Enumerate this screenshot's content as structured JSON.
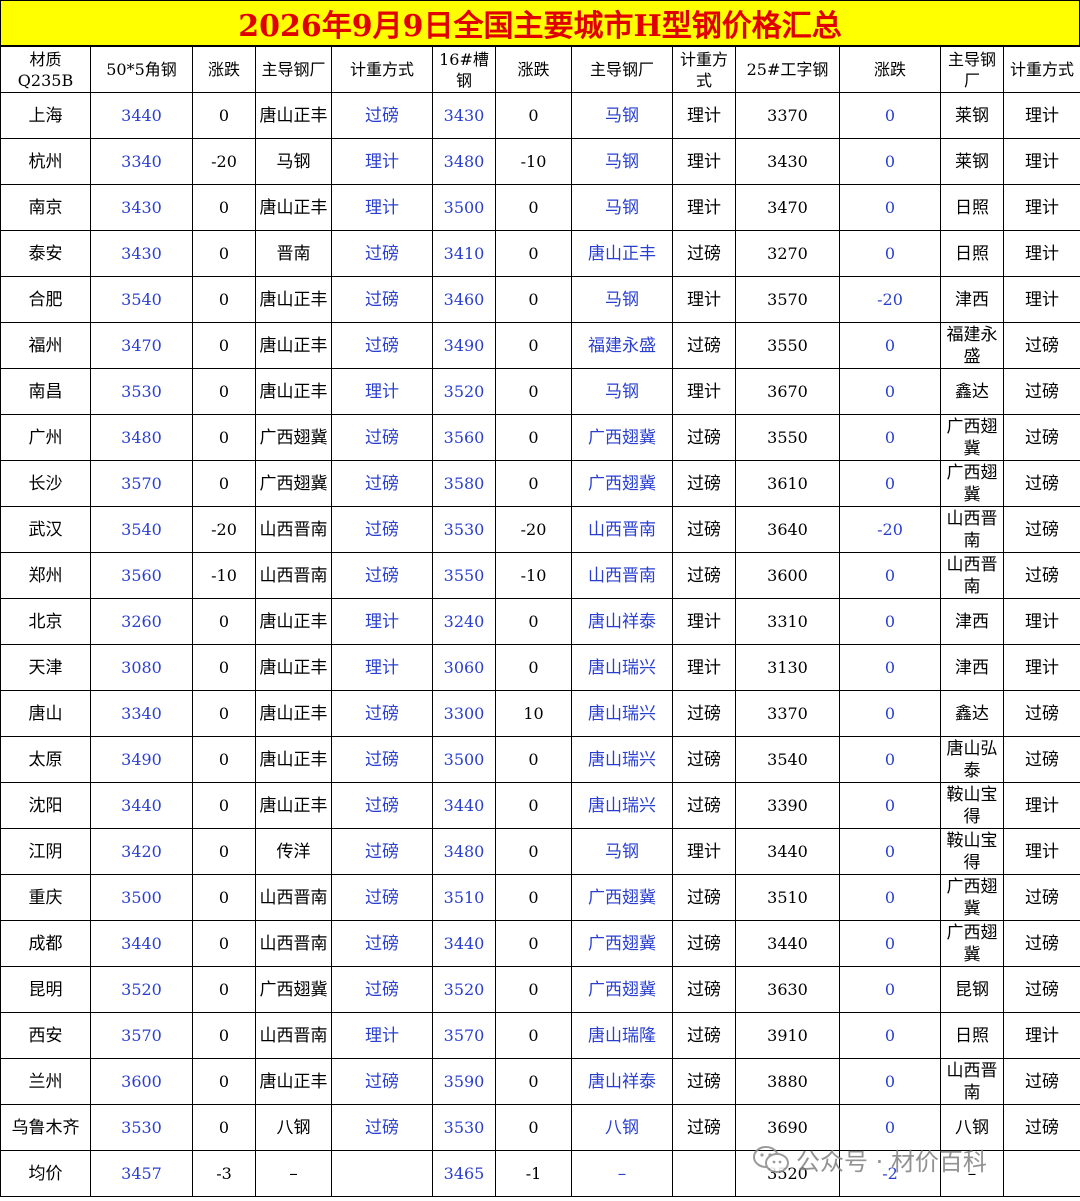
{
  "title": "2026年9月9日全国主要城市H型钢价格汇总",
  "headers": [
    "材质Q235B",
    "50*5角钢",
    "涨跌",
    "主导钢厂",
    "计重方式",
    "16#槽钢",
    "涨跌",
    "主导钢厂",
    "计重方式",
    "25#工字钢",
    "涨跌",
    "主导钢厂",
    "计重方式"
  ],
  "rows": [
    [
      "上海",
      "3440",
      "0",
      "唐山正丰",
      "过磅",
      "3430",
      "0",
      "马钢",
      "理计",
      "3370",
      "0",
      "莱钢",
      "理计"
    ],
    [
      "杭州",
      "3340",
      "-20",
      "马钢",
      "理计",
      "3480",
      "-10",
      "马钢",
      "理计",
      "3430",
      "0",
      "莱钢",
      "理计"
    ],
    [
      "南京",
      "3430",
      "0",
      "唐山正丰",
      "理计",
      "3500",
      "0",
      "马钢",
      "理计",
      "3470",
      "0",
      "日照",
      "理计"
    ],
    [
      "泰安",
      "3430",
      "0",
      "晋南",
      "过磅",
      "3410",
      "0",
      "唐山正丰",
      "过磅",
      "3270",
      "0",
      "日照",
      "理计"
    ],
    [
      "合肥",
      "3540",
      "0",
      "唐山正丰",
      "过磅",
      "3460",
      "0",
      "马钢",
      "理计",
      "3570",
      "-20",
      "津西",
      "理计"
    ],
    [
      "福州",
      "3470",
      "0",
      "唐山正丰",
      "过磅",
      "3490",
      "0",
      "福建永盛",
      "过磅",
      "3550",
      "0",
      "福建永盛",
      "过磅"
    ],
    [
      "南昌",
      "3530",
      "0",
      "唐山正丰",
      "理计",
      "3520",
      "0",
      "马钢",
      "理计",
      "3670",
      "0",
      "鑫达",
      "过磅"
    ],
    [
      "广州",
      "3480",
      "0",
      "广西翅冀",
      "过磅",
      "3560",
      "0",
      "广西翅冀",
      "过磅",
      "3550",
      "0",
      "广西翅冀",
      "过磅"
    ],
    [
      "长沙",
      "3570",
      "0",
      "广西翅冀",
      "过磅",
      "3580",
      "0",
      "广西翅冀",
      "过磅",
      "3610",
      "0",
      "广西翅冀",
      "过磅"
    ],
    [
      "武汉",
      "3540",
      "-20",
      "山西晋南",
      "过磅",
      "3530",
      "-20",
      "山西晋南",
      "过磅",
      "3640",
      "-20",
      "山西晋南",
      "过磅"
    ],
    [
      "郑州",
      "3560",
      "-10",
      "山西晋南",
      "过磅",
      "3550",
      "-10",
      "山西晋南",
      "过磅",
      "3600",
      "0",
      "山西晋南",
      "过磅"
    ],
    [
      "北京",
      "3260",
      "0",
      "唐山正丰",
      "理计",
      "3240",
      "0",
      "唐山祥泰",
      "理计",
      "3310",
      "0",
      "津西",
      "理计"
    ],
    [
      "天津",
      "3080",
      "0",
      "唐山正丰",
      "理计",
      "3060",
      "0",
      "唐山瑞兴",
      "理计",
      "3130",
      "0",
      "津西",
      "理计"
    ],
    [
      "唐山",
      "3340",
      "0",
      "唐山正丰",
      "过磅",
      "3300",
      "10",
      "唐山瑞兴",
      "过磅",
      "3370",
      "0",
      "鑫达",
      "过磅"
    ],
    [
      "太原",
      "3490",
      "0",
      "唐山正丰",
      "过磅",
      "3500",
      "0",
      "唐山瑞兴",
      "过磅",
      "3540",
      "0",
      "唐山弘泰",
      "过磅"
    ],
    [
      "沈阳",
      "3440",
      "0",
      "唐山正丰",
      "过磅",
      "3440",
      "0",
      "唐山瑞兴",
      "过磅",
      "3390",
      "0",
      "鞍山宝得",
      "理计"
    ],
    [
      "江阴",
      "3420",
      "0",
      "传洋",
      "过磅",
      "3480",
      "0",
      "马钢",
      "理计",
      "3440",
      "0",
      "鞍山宝得",
      "理计"
    ],
    [
      "重庆",
      "3500",
      "0",
      "山西晋南",
      "过磅",
      "3510",
      "0",
      "广西翅冀",
      "过磅",
      "3510",
      "0",
      "广西翅冀",
      "过磅"
    ],
    [
      "成都",
      "3440",
      "0",
      "山西晋南",
      "过磅",
      "3440",
      "0",
      "广西翅冀",
      "过磅",
      "3440",
      "0",
      "广西翅冀",
      "过磅"
    ],
    [
      "昆明",
      "3520",
      "0",
      "广西翅冀",
      "过磅",
      "3520",
      "0",
      "广西翅冀",
      "过磅",
      "3630",
      "0",
      "昆钢",
      "过磅"
    ],
    [
      "西安",
      "3570",
      "0",
      "山西晋南",
      "理计",
      "3570",
      "0",
      "唐山瑞隆",
      "过磅",
      "3910",
      "0",
      "日照",
      "理计"
    ],
    [
      "兰州",
      "3600",
      "0",
      "唐山正丰",
      "过磅",
      "3590",
      "0",
      "唐山祥泰",
      "过磅",
      "3880",
      "0",
      "山西晋南",
      "过磅"
    ],
    [
      "乌鲁木齐",
      "3530",
      "0",
      "八钢",
      "过磅",
      "3530",
      "0",
      "八钢",
      "过磅",
      "3690",
      "0",
      "八钢",
      "过磅"
    ],
    [
      "均价",
      "3457",
      "-3",
      "–",
      "",
      "3465",
      "-1",
      "–",
      "",
      "3520",
      "-2",
      "–",
      ""
    ]
  ],
  "watermark": {
    "text": "公众号 · 材价百科",
    "icon": "wechat-icon"
  },
  "colors": {
    "title_bg": "#ffff00",
    "title_text": "#e00000",
    "blue_text": "#2a3fd0",
    "border": "#000000"
  }
}
